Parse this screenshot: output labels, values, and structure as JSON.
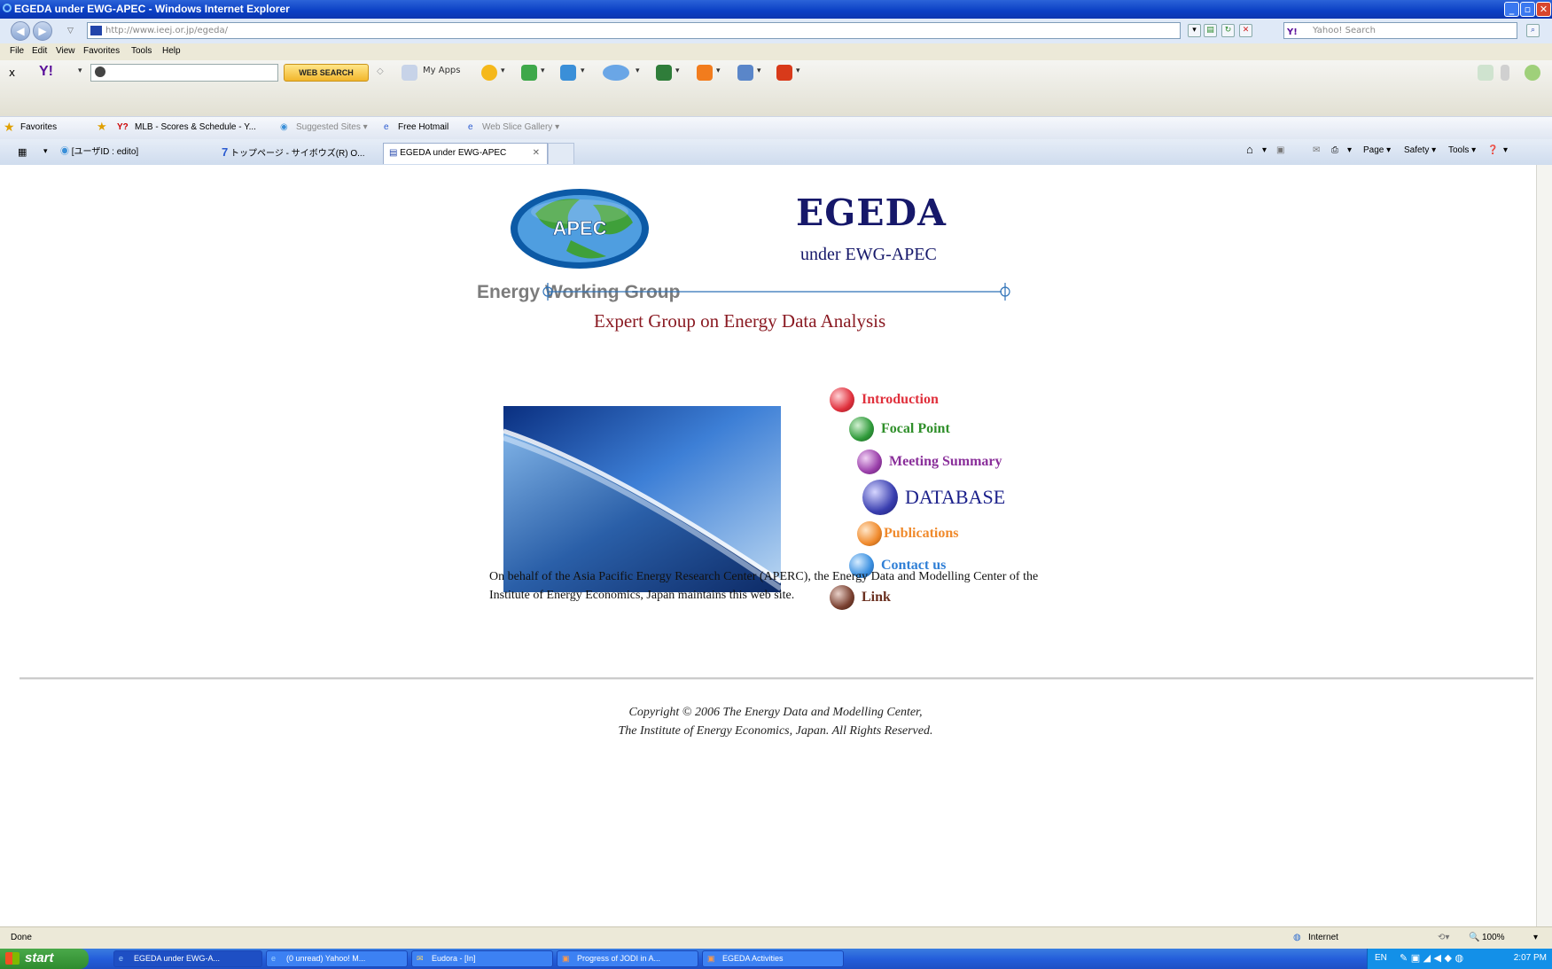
{
  "window": {
    "title": "EGEDA under EWG-APEC - Windows Internet Explorer"
  },
  "address_bar": {
    "url": "http://www.ieej.or.jp/egeda/",
    "search_placeholder": "Yahoo! Search"
  },
  "menu": [
    "File",
    "Edit",
    "View",
    "Favorites",
    "Tools",
    "Help"
  ],
  "yahoo_toolbar": {
    "search_button": "WEB SEARCH",
    "my_apps": "My Apps"
  },
  "favorites_bar": {
    "favorites": "Favorites",
    "items": [
      "MLB - Scores & Schedule - Y...",
      "Suggested Sites ▾",
      "Free Hotmail",
      "Web Slice Gallery ▾"
    ]
  },
  "tabs": [
    {
      "label": "[ユーザID : edito]"
    },
    {
      "label": "トップページ - サイボウズ(R) O..."
    },
    {
      "label": "EGEDA under EWG-APEC"
    }
  ],
  "command_bar": [
    "Page ▾",
    "Safety ▾",
    "Tools ▾"
  ],
  "page": {
    "logo_text": "APEC",
    "ewg": "Energy Working Group",
    "title": "EGEDA",
    "subtitle": "under EWG-APEC",
    "expert_group": "Expert Group on Energy Data Analysis",
    "nav": [
      {
        "label": "Introduction",
        "color": "#e0303c"
      },
      {
        "label": "Focal Point",
        "color": "#2f8f2a"
      },
      {
        "label": "Meeting Summary",
        "color": "#8a2f9a"
      },
      {
        "label": "DATABASE",
        "color": "#1a1f8a"
      },
      {
        "label": "Publications",
        "color": "#f08a2c"
      },
      {
        "label": "Contact us",
        "color": "#2f7fd6"
      },
      {
        "label": "Link",
        "color": "#6a2f1f"
      }
    ],
    "owner_text": "On behalf of the Asia Pacific Energy Research Center (APERC), the Energy Data and Modelling Center of the Institute of Energy Economics, Japan maintains this web site.",
    "copyright_line1": "Copyright © 2006 The Energy Data and Modelling Center,",
    "copyright_line2": "The Institute of Energy Economics, Japan. All Rights Reserved."
  },
  "status": {
    "left": "Done",
    "zone": "Internet",
    "zoom": "100%"
  },
  "taskbar": {
    "start": "start",
    "buttons": [
      "EGEDA under EWG-A...",
      "(0 unread) Yahoo! M...",
      "Eudora - [In]",
      "Progress of JODI in A...",
      "EGEDA Activities"
    ],
    "lang": "EN",
    "clock": "2:07 PM"
  }
}
